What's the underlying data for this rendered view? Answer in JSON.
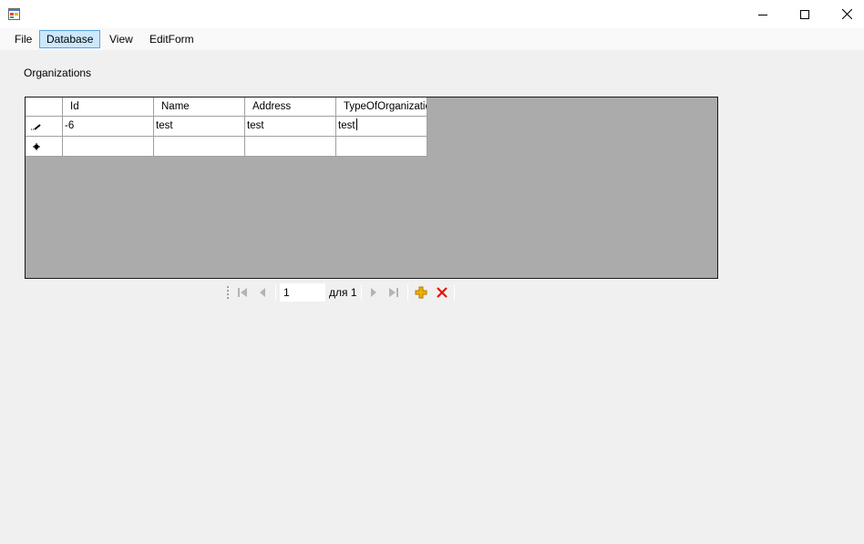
{
  "window": {
    "title": "",
    "icon": "app-form-icon",
    "controls": [
      "minimize-icon",
      "maximize-icon",
      "close-icon"
    ]
  },
  "menu": {
    "items": [
      {
        "label": "File"
      },
      {
        "label": "Database",
        "active": true
      },
      {
        "label": "View"
      },
      {
        "label": "EditForm"
      }
    ]
  },
  "section_label": "Organizations",
  "grid": {
    "columns": [
      "Id",
      "Name",
      "Address",
      "TypeOfOrganizatior"
    ],
    "rows": [
      {
        "indicator": "pencil-icon",
        "cells": [
          "-6",
          "test",
          "test",
          "test"
        ]
      },
      {
        "indicator": "new-row-icon",
        "cells": [
          "",
          "",
          "",
          ""
        ]
      }
    ],
    "background_color": "#ababab"
  },
  "navigator": {
    "position": "1",
    "count_label": "для 1",
    "buttons": [
      "move-first-icon",
      "move-previous-icon",
      "move-next-icon",
      "move-last-icon",
      "add-new-icon",
      "delete-icon"
    ],
    "colors": {
      "add": "#f2b000",
      "delete": "#e51400"
    }
  }
}
